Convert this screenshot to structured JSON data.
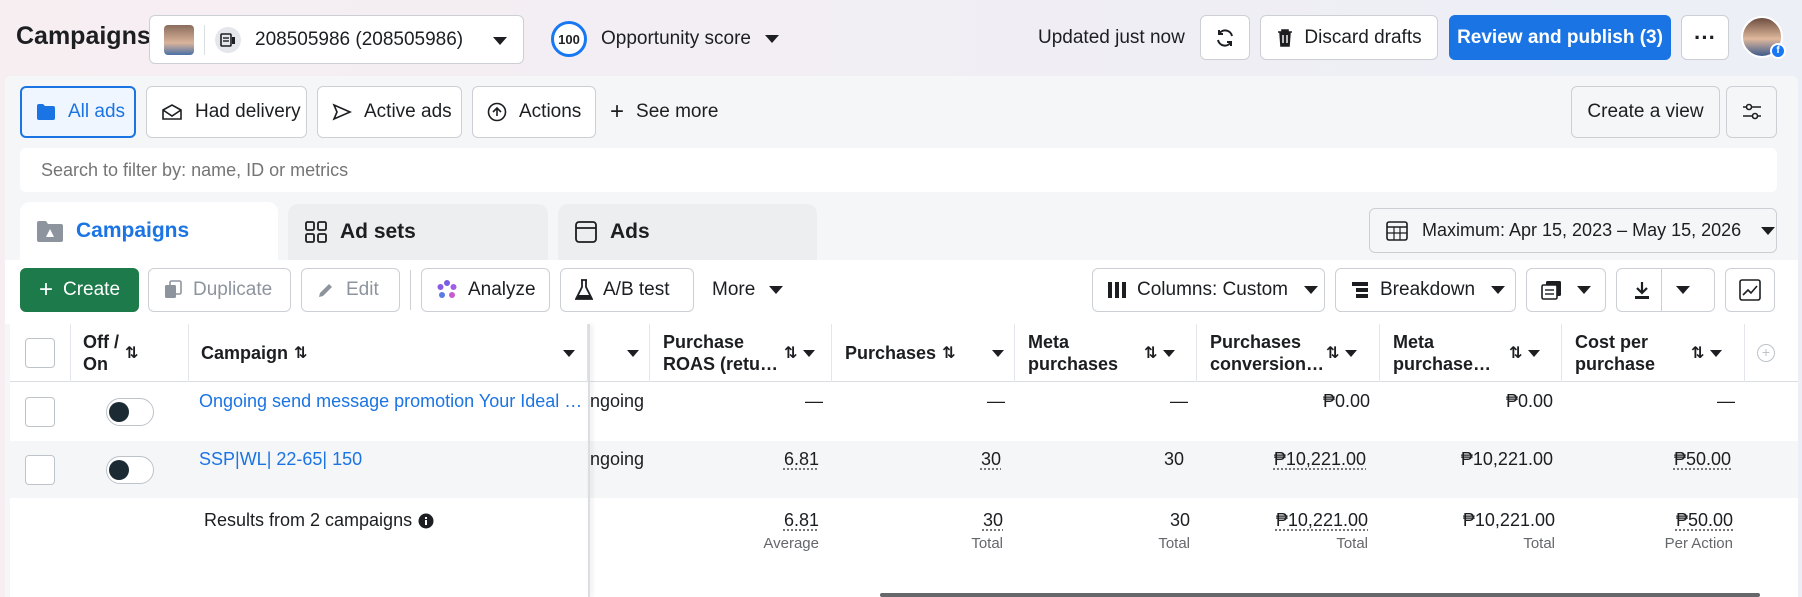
{
  "header": {
    "title": "Campaigns",
    "account_label": "208505986 (208505986)",
    "opportunity_score": "100",
    "opportunity_label": "Opportunity score",
    "updated_text": "Updated just now",
    "discard_label": "Discard drafts",
    "publish_label": "Review and publish (3)",
    "more_label": "···"
  },
  "filters": {
    "all_ads": "All ads",
    "had_delivery": "Had delivery",
    "active_ads": "Active ads",
    "actions": "Actions",
    "see_more": "See more",
    "create_view": "Create a view"
  },
  "search": {
    "placeholder": "Search to filter by: name, ID or metrics"
  },
  "tabs": {
    "campaigns": "Campaigns",
    "ad_sets": "Ad sets",
    "ads": "Ads"
  },
  "date_range": "Maximum: Apr 15, 2023 – May 15, 2026",
  "toolbar": {
    "create": "Create",
    "duplicate": "Duplicate",
    "edit": "Edit",
    "analyze": "Analyze",
    "ab_test": "A/B test",
    "more": "More",
    "columns": "Columns: Custom",
    "breakdown": "Breakdown"
  },
  "table": {
    "headers": {
      "off_on_1": "Off /",
      "off_on_2": "On",
      "campaign": "Campaign",
      "roas_1": "Purchase",
      "roas_2": "ROAS (retu…",
      "purchases": "Purchases",
      "meta_purchases_1": "Meta",
      "meta_purchases_2": "purchases",
      "conv_1": "Purchases",
      "conv_2": "conversion…",
      "meta_val_1": "Meta",
      "meta_val_2": "purchase…",
      "cpp_1": "Cost per",
      "cpp_2": "purchase"
    },
    "rows": [
      {
        "name": "Ongoing send message promotion Your Ideal …",
        "delivery": "ngoing",
        "roas": "—",
        "purchases": "—",
        "meta_purchases": "—",
        "conv_value": "₱0.00",
        "meta_value": "₱0.00",
        "cpp": "—"
      },
      {
        "name": "SSP|WL| 22-65| 150",
        "delivery": "ngoing",
        "roas": "6.81",
        "purchases": "30",
        "meta_purchases": "30",
        "conv_value": "₱10,221.00",
        "meta_value": "₱10,221.00",
        "cpp": "₱50.00"
      }
    ],
    "summary": {
      "label": "Results from 2 campaigns",
      "roas": "6.81",
      "roas_sub": "Average",
      "purchases": "30",
      "purchases_sub": "Total",
      "meta_purchases": "30",
      "meta_purchases_sub": "Total",
      "conv_value": "₱10,221.00",
      "conv_value_sub": "Total",
      "meta_value": "₱10,221.00",
      "meta_value_sub": "Total",
      "cpp": "₱50.00",
      "cpp_sub": "Per Action"
    }
  }
}
